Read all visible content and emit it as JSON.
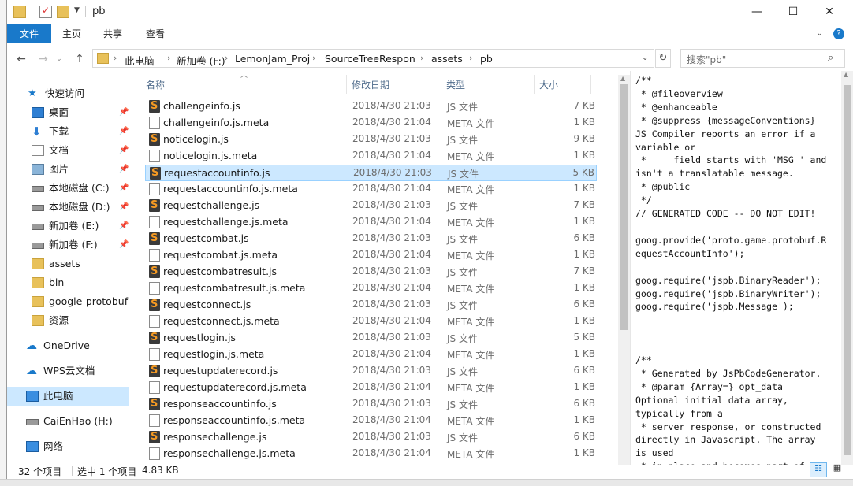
{
  "window": {
    "title": "pb"
  },
  "ribbon": {
    "tabs": [
      "文件",
      "主页",
      "共享",
      "查看"
    ]
  },
  "address": {
    "crumbs": [
      "此电脑",
      "新加卷 (F:)",
      "LemonJam_Proj",
      "SourceTreeRespon",
      "assets",
      "pb"
    ]
  },
  "search": {
    "placeholder": "搜索\"pb\""
  },
  "nav": {
    "items": [
      {
        "label": "快速访问",
        "icon": "star-icon"
      },
      {
        "label": "桌面",
        "icon": "desktop-icon",
        "pinned": true
      },
      {
        "label": "下载",
        "icon": "download-icon",
        "pinned": true
      },
      {
        "label": "文档",
        "icon": "document-icon",
        "pinned": true
      },
      {
        "label": "图片",
        "icon": "picture-icon",
        "pinned": true
      },
      {
        "label": "本地磁盘 (C:)",
        "icon": "drive-icon",
        "pinned": true
      },
      {
        "label": "本地磁盘 (D:)",
        "icon": "drive-icon",
        "pinned": true
      },
      {
        "label": "新加卷 (E:)",
        "icon": "drive-icon",
        "pinned": true
      },
      {
        "label": "新加卷 (F:)",
        "icon": "drive-icon",
        "pinned": true
      },
      {
        "label": "assets",
        "icon": "folder-icon"
      },
      {
        "label": "bin",
        "icon": "folder-icon"
      },
      {
        "label": "google-protobuf",
        "icon": "folder-icon"
      },
      {
        "label": "资源",
        "icon": "folder-icon"
      },
      {
        "label": "OneDrive",
        "icon": "cloud-icon"
      },
      {
        "label": "WPS云文档",
        "icon": "cloud-icon"
      },
      {
        "label": "此电脑",
        "icon": "computer-icon",
        "selected": true
      },
      {
        "label": "CaiEnHao (H:)",
        "icon": "drive-icon"
      },
      {
        "label": "网络",
        "icon": "network-icon"
      }
    ]
  },
  "columns": {
    "name": "名称",
    "date": "修改日期",
    "type": "类型",
    "size": "大小"
  },
  "files": [
    {
      "name": "challengeinfo.js",
      "date": "2018/4/30 21:03",
      "type": "JS 文件",
      "size": "7 KB",
      "kind": "js"
    },
    {
      "name": "challengeinfo.js.meta",
      "date": "2018/4/30 21:04",
      "type": "META 文件",
      "size": "1 KB",
      "kind": "meta"
    },
    {
      "name": "noticelogin.js",
      "date": "2018/4/30 21:03",
      "type": "JS 文件",
      "size": "9 KB",
      "kind": "js"
    },
    {
      "name": "noticelogin.js.meta",
      "date": "2018/4/30 21:04",
      "type": "META 文件",
      "size": "1 KB",
      "kind": "meta"
    },
    {
      "name": "requestaccountinfo.js",
      "date": "2018/4/30 21:03",
      "type": "JS 文件",
      "size": "5 KB",
      "kind": "js",
      "selected": true
    },
    {
      "name": "requestaccountinfo.js.meta",
      "date": "2018/4/30 21:04",
      "type": "META 文件",
      "size": "1 KB",
      "kind": "meta"
    },
    {
      "name": "requestchallenge.js",
      "date": "2018/4/30 21:03",
      "type": "JS 文件",
      "size": "7 KB",
      "kind": "js"
    },
    {
      "name": "requestchallenge.js.meta",
      "date": "2018/4/30 21:04",
      "type": "META 文件",
      "size": "1 KB",
      "kind": "meta"
    },
    {
      "name": "requestcombat.js",
      "date": "2018/4/30 21:03",
      "type": "JS 文件",
      "size": "6 KB",
      "kind": "js"
    },
    {
      "name": "requestcombat.js.meta",
      "date": "2018/4/30 21:04",
      "type": "META 文件",
      "size": "1 KB",
      "kind": "meta"
    },
    {
      "name": "requestcombatresult.js",
      "date": "2018/4/30 21:03",
      "type": "JS 文件",
      "size": "7 KB",
      "kind": "js"
    },
    {
      "name": "requestcombatresult.js.meta",
      "date": "2018/4/30 21:04",
      "type": "META 文件",
      "size": "1 KB",
      "kind": "meta"
    },
    {
      "name": "requestconnect.js",
      "date": "2018/4/30 21:03",
      "type": "JS 文件",
      "size": "6 KB",
      "kind": "js"
    },
    {
      "name": "requestconnect.js.meta",
      "date": "2018/4/30 21:04",
      "type": "META 文件",
      "size": "1 KB",
      "kind": "meta"
    },
    {
      "name": "requestlogin.js",
      "date": "2018/4/30 21:03",
      "type": "JS 文件",
      "size": "5 KB",
      "kind": "js"
    },
    {
      "name": "requestlogin.js.meta",
      "date": "2018/4/30 21:04",
      "type": "META 文件",
      "size": "1 KB",
      "kind": "meta"
    },
    {
      "name": "requestupdaterecord.js",
      "date": "2018/4/30 21:03",
      "type": "JS 文件",
      "size": "6 KB",
      "kind": "js"
    },
    {
      "name": "requestupdaterecord.js.meta",
      "date": "2018/4/30 21:04",
      "type": "META 文件",
      "size": "1 KB",
      "kind": "meta"
    },
    {
      "name": "responseaccountinfo.js",
      "date": "2018/4/30 21:03",
      "type": "JS 文件",
      "size": "6 KB",
      "kind": "js"
    },
    {
      "name": "responseaccountinfo.js.meta",
      "date": "2018/4/30 21:04",
      "type": "META 文件",
      "size": "1 KB",
      "kind": "meta"
    },
    {
      "name": "responsechallenge.js",
      "date": "2018/4/30 21:03",
      "type": "JS 文件",
      "size": "6 KB",
      "kind": "js"
    },
    {
      "name": "responsechallenge.js.meta",
      "date": "2018/4/30 21:04",
      "type": "META 文件",
      "size": "1 KB",
      "kind": "meta"
    }
  ],
  "preview": {
    "text": "/**\n * @fileoverview\n * @enhanceable\n * @suppress {messageConventions}\nJS Compiler reports an error if a\nvariable or\n *     field starts with 'MSG_' and\nisn't a translatable message.\n * @public\n */\n// GENERATED CODE -- DO NOT EDIT!\n\ngoog.provide('proto.game.protobuf.R\nequestAccountInfo');\n\ngoog.require('jspb.BinaryReader');\ngoog.require('jspb.BinaryWriter');\ngoog.require('jspb.Message');\n\n\n\n/**\n * Generated by JsPbCodeGenerator.\n * @param {Array=} opt_data\nOptional initial data array,\ntypically from a\n * server response, or constructed\ndirectly in Javascript. The array\nis used\n * in place and becomes part of the"
  },
  "status": {
    "count": "32 个项目",
    "selected": "选中 1 个项目",
    "size": "4.83 KB"
  },
  "colors": {
    "accent": "#1979ca",
    "selection": "#cce8ff"
  }
}
